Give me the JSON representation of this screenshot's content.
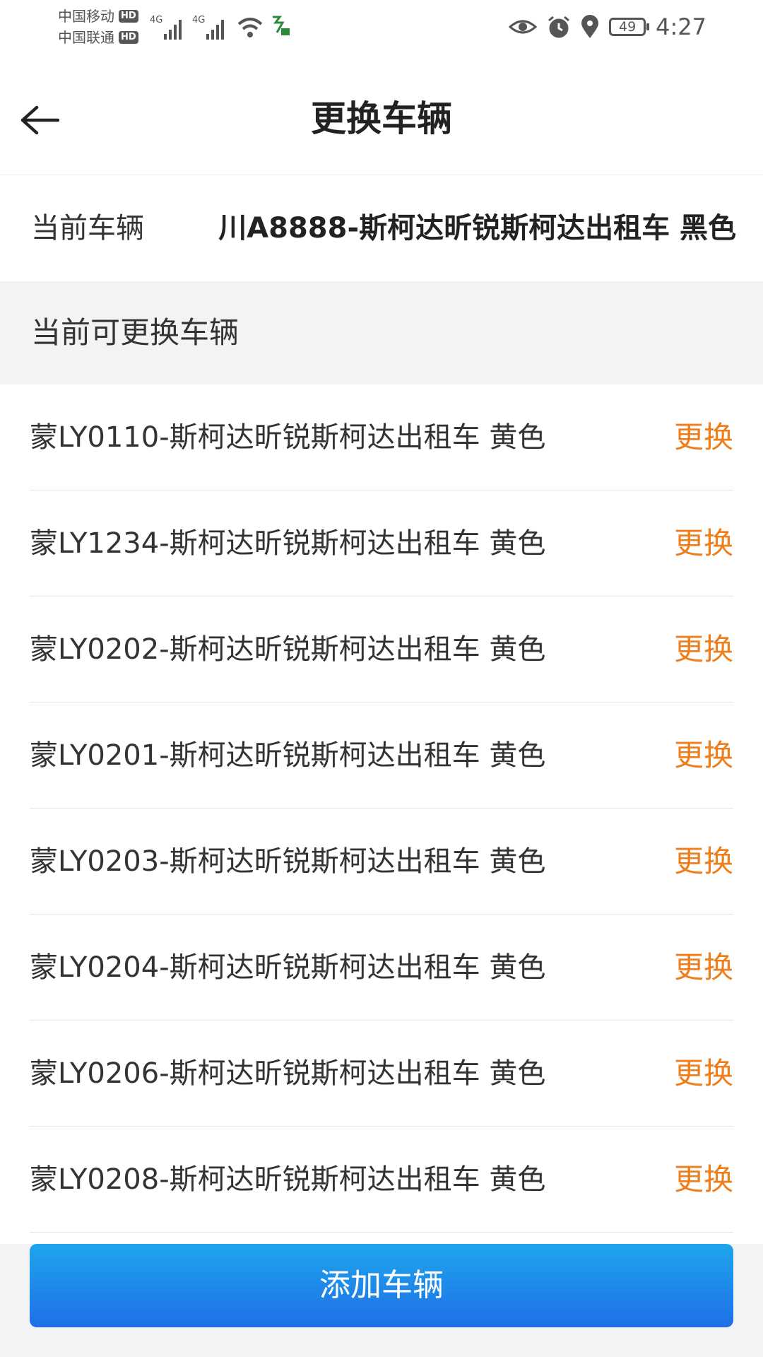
{
  "status_bar": {
    "carrier_1": "中国移动",
    "carrier_2": "中国联通",
    "hd_label": "HD",
    "network_1": "4G",
    "network_2": "4G",
    "battery": "49",
    "time": "4:27"
  },
  "header": {
    "title": "更换车辆",
    "back_icon": "arrow-left-icon"
  },
  "current_vehicle": {
    "label": "当前车辆",
    "value": "川A8888-斯柯达昕锐斯柯达出租车 黑色"
  },
  "available_section": {
    "title": "当前可更换车辆"
  },
  "vehicles": [
    {
      "name": "蒙LY0110-斯柯达昕锐斯柯达出租车 黄色",
      "action": "更换"
    },
    {
      "name": "蒙LY1234-斯柯达昕锐斯柯达出租车 黄色",
      "action": "更换"
    },
    {
      "name": "蒙LY0202-斯柯达昕锐斯柯达出租车 黄色",
      "action": "更换"
    },
    {
      "name": "蒙LY0201-斯柯达昕锐斯柯达出租车 黄色",
      "action": "更换"
    },
    {
      "name": "蒙LY0203-斯柯达昕锐斯柯达出租车 黄色",
      "action": "更换"
    },
    {
      "name": "蒙LY0204-斯柯达昕锐斯柯达出租车 黄色",
      "action": "更换"
    },
    {
      "name": "蒙LY0206-斯柯达昕锐斯柯达出租车 黄色",
      "action": "更换"
    },
    {
      "name": "蒙LY0208-斯柯达昕锐斯柯达出租车 黄色",
      "action": "更换"
    }
  ],
  "footer": {
    "add_button": "添加车辆"
  },
  "colors": {
    "accent": "#ee7d1a",
    "button_top": "#1ea6ec",
    "button_bottom": "#1f6fe6"
  }
}
